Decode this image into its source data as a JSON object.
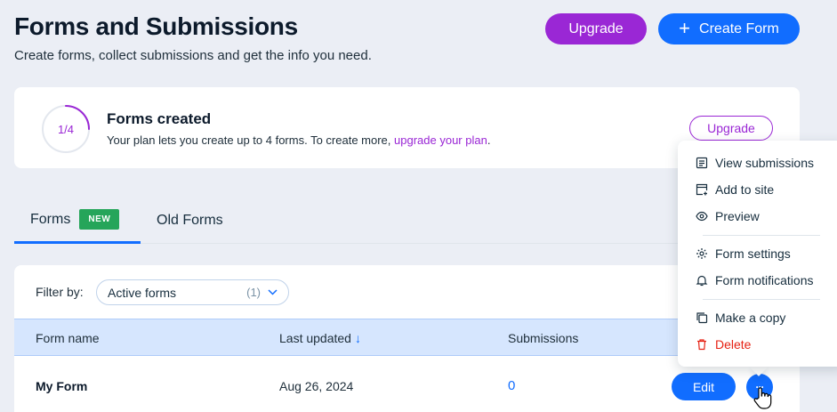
{
  "header": {
    "title": "Forms and Submissions",
    "subtitle": "Create forms, collect submissions and get the info you need.",
    "upgrade_label": "Upgrade",
    "create_label": "Create Form"
  },
  "quota": {
    "count_text": "1/4",
    "used": 1,
    "limit": 4,
    "title": "Forms created",
    "desc_prefix": "Your plan lets you create up to 4 forms. To create more, ",
    "desc_link": "upgrade your plan",
    "desc_suffix": ".",
    "upgrade_label": "Upgrade"
  },
  "tabs": [
    {
      "label": "Forms",
      "badge": "NEW",
      "active": true
    },
    {
      "label": "Old Forms",
      "active": false
    }
  ],
  "filter": {
    "label": "Filter by:",
    "selected": "Active forms",
    "count": "(1)"
  },
  "table": {
    "columns": [
      "Form name",
      "Last updated",
      "Submissions"
    ],
    "sort_indicator": "↓",
    "rows": [
      {
        "name": "My Form",
        "updated": "Aug 26, 2024",
        "submissions": "0",
        "edit_label": "Edit",
        "more_label": "···"
      }
    ]
  },
  "menu": {
    "items": [
      {
        "label": "View submissions",
        "icon": "list-icon"
      },
      {
        "label": "Add to site",
        "icon": "add-to-site-icon"
      },
      {
        "label": "Preview",
        "icon": "eye-icon"
      },
      {
        "label": "Form settings",
        "icon": "gear-icon"
      },
      {
        "label": "Form notifications",
        "icon": "bell-icon"
      },
      {
        "label": "Make a copy",
        "icon": "copy-icon"
      },
      {
        "label": "Delete",
        "icon": "trash-icon",
        "danger": true
      }
    ]
  },
  "colors": {
    "background": "#ebeef5",
    "accent_blue": "#116dff",
    "upgrade_purple": "#9a27d5",
    "badge_green": "#25a55a",
    "danger_red": "#e62214",
    "table_header": "#d6e6fe"
  }
}
